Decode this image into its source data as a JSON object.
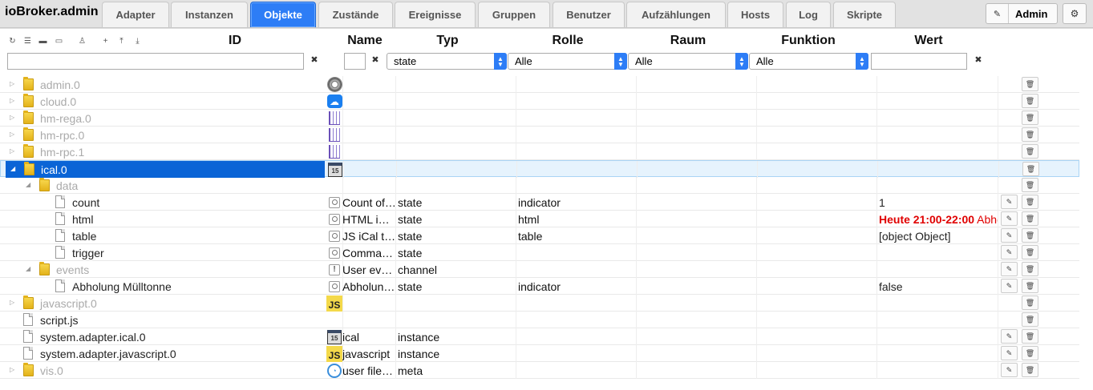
{
  "app": {
    "title": "ioBroker.admin"
  },
  "tabs": [
    "Adapter",
    "Instanzen",
    "Objekte",
    "Zustände",
    "Ereignisse",
    "Gruppen",
    "Benutzer",
    "Aufzählungen",
    "Hosts",
    "Log",
    "Skripte"
  ],
  "active_tab": "Objekte",
  "user": {
    "name": "Admin",
    "edit_icon": "pencil-icon",
    "settings_icon": "gear-icon"
  },
  "toolbar": {
    "icons": [
      "refresh-icon",
      "list-icon",
      "folder-closed-icon",
      "folder-open-icon",
      "user-icon",
      "add-icon",
      "upload-icon",
      "download-icon"
    ]
  },
  "columns": {
    "id": "ID",
    "name": "Name",
    "type": "Typ",
    "role": "Rolle",
    "room": "Raum",
    "function": "Funktion",
    "value": "Wert"
  },
  "filters": {
    "id": "",
    "name": "",
    "type": "state",
    "role": "Alle",
    "room": "Alle",
    "function": "Alle",
    "value": "",
    "clear_glyph": "✖"
  },
  "accent_color": "#2d7df6",
  "rows": [
    {
      "id": "admin.0",
      "name": "",
      "type": "",
      "role": "",
      "value": "",
      "icon": "gear-icon"
    },
    {
      "id": "cloud.0",
      "name": "",
      "type": "",
      "role": "",
      "value": "",
      "icon": "cloud-icon"
    },
    {
      "id": "hm-rega.0",
      "name": "",
      "type": "",
      "role": "",
      "value": "",
      "icon": "homematic-icon"
    },
    {
      "id": "hm-rpc.0",
      "name": "",
      "type": "",
      "role": "",
      "value": "",
      "icon": "homematic-icon"
    },
    {
      "id": "hm-rpc.1",
      "name": "",
      "type": "",
      "role": "",
      "value": "",
      "icon": "homematic-icon"
    },
    {
      "id": "ical.0",
      "name": "",
      "type": "",
      "role": "",
      "value": "",
      "icon": "calendar-icon"
    },
    {
      "id": "data",
      "name": "",
      "type": "",
      "role": "",
      "value": "",
      "icon": ""
    },
    {
      "id": "count",
      "name": "Count of…",
      "type": "state",
      "role": "indicator",
      "value": "1",
      "icon": "state-icon"
    },
    {
      "id": "html",
      "name": "HTML i…",
      "type": "state",
      "role": "html",
      "value_bold": "Heute 21:00-22:00",
      "value": "Abholung Mülltonne",
      "icon": "state-icon"
    },
    {
      "id": "table",
      "name": "JS iCal t…",
      "type": "state",
      "role": "table",
      "value": "[object Object]",
      "icon": "state-icon"
    },
    {
      "id": "trigger",
      "name": "Comma…",
      "type": "state",
      "role": "",
      "value": "",
      "icon": "state-icon"
    },
    {
      "id": "events",
      "name": "User ev…",
      "type": "channel",
      "role": "",
      "value": "",
      "icon": "channel-icon"
    },
    {
      "id": "Abholung Mülltonne",
      "name": "Abholun…",
      "type": "state",
      "role": "indicator",
      "value": "false",
      "icon": "state-icon"
    },
    {
      "id": "javascript.0",
      "name": "",
      "type": "",
      "role": "",
      "value": "",
      "icon": "javascript-icon"
    },
    {
      "id": "script.js",
      "name": "",
      "type": "",
      "role": "",
      "value": "",
      "icon": ""
    },
    {
      "id": "system.adapter.ical.0",
      "name": "ical",
      "type": "instance",
      "role": "",
      "value": "",
      "icon": "calendar-icon"
    },
    {
      "id": "system.adapter.javascript.0",
      "name": "javascript",
      "type": "instance",
      "role": "",
      "value": "",
      "icon": "javascript-icon"
    },
    {
      "id": "vis.0",
      "name": "user file…",
      "type": "meta",
      "role": "",
      "value": "",
      "icon": "vis-icon"
    }
  ],
  "icon_text": {
    "cal": "15",
    "js": "JS",
    "chan": "!",
    "cloud": "☁",
    "vis": "◔"
  },
  "action_glyphs": {
    "edit": "✎",
    "delete": "🗑"
  }
}
